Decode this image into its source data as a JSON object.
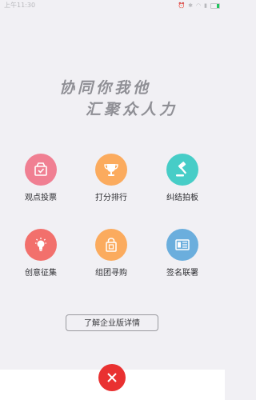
{
  "status_bar": {
    "time": "上午11:30"
  },
  "slogan": {
    "line1": "协同你我他",
    "line2": "汇聚众人力"
  },
  "grid": [
    {
      "label": "观点投票",
      "icon": "vote-box-icon",
      "color": "#f07f92"
    },
    {
      "label": "打分排行",
      "icon": "trophy-icon",
      "color": "#fbab5e"
    },
    {
      "label": "纠结拍板",
      "icon": "gavel-icon",
      "color": "#47cdc7"
    },
    {
      "label": "创意征集",
      "icon": "lightbulb-icon",
      "color": "#f2706c"
    },
    {
      "label": "组团寻购",
      "icon": "shopping-bag-icon",
      "color": "#fbab5e"
    },
    {
      "label": "签名联署",
      "icon": "document-icon",
      "color": "#6baedd"
    }
  ],
  "enterprise_button": {
    "label": "了解企业版详情"
  },
  "close_button": {
    "icon": "close-icon",
    "color": "#e93131"
  }
}
